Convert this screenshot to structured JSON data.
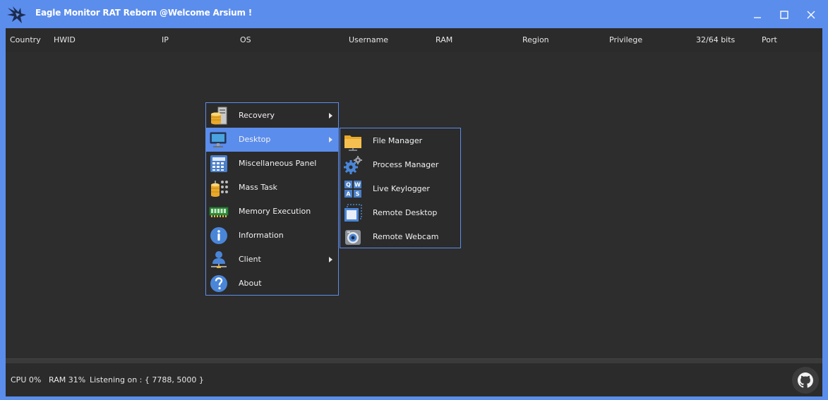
{
  "window": {
    "title": "Eagle Monitor RAT Reborn @Welcome Arsium !",
    "accent": "#5b8dec"
  },
  "columns": [
    "Country",
    "HWID",
    "IP",
    "OS",
    "Username",
    "RAM",
    "Region",
    "Privilege",
    "32/64 bits",
    "Port"
  ],
  "statusbar": {
    "cpu": "CPU 0%",
    "ram": "RAM 31%",
    "listening": "Listening on : { 7788, 5000 }"
  },
  "context_menu": {
    "items": [
      {
        "label": "Recovery",
        "icon": "database-server-icon",
        "submenu": true
      },
      {
        "label": "Desktop",
        "icon": "monitor-icon",
        "submenu": true,
        "active": true
      },
      {
        "label": "Miscellaneous Panel",
        "icon": "calculator-panel-icon",
        "submenu": false
      },
      {
        "label": "Mass Task",
        "icon": "mass-database-icon",
        "submenu": false
      },
      {
        "label": "Memory Execution",
        "icon": "memory-chip-icon",
        "submenu": false
      },
      {
        "label": "Information",
        "icon": "info-icon",
        "submenu": false
      },
      {
        "label": "Client",
        "icon": "user-network-icon",
        "submenu": true
      },
      {
        "label": "About",
        "icon": "help-icon",
        "submenu": false
      }
    ]
  },
  "desktop_submenu": {
    "items": [
      {
        "label": "File Manager",
        "icon": "folder-icon"
      },
      {
        "label": "Process Manager",
        "icon": "gears-icon"
      },
      {
        "label": "Live Keylogger",
        "icon": "keyboard-keys-icon",
        "keys": [
          "Q",
          "W",
          "A",
          "S"
        ]
      },
      {
        "label": "Remote Desktop",
        "icon": "remote-screen-icon"
      },
      {
        "label": "Remote Webcam",
        "icon": "webcam-icon"
      }
    ]
  }
}
